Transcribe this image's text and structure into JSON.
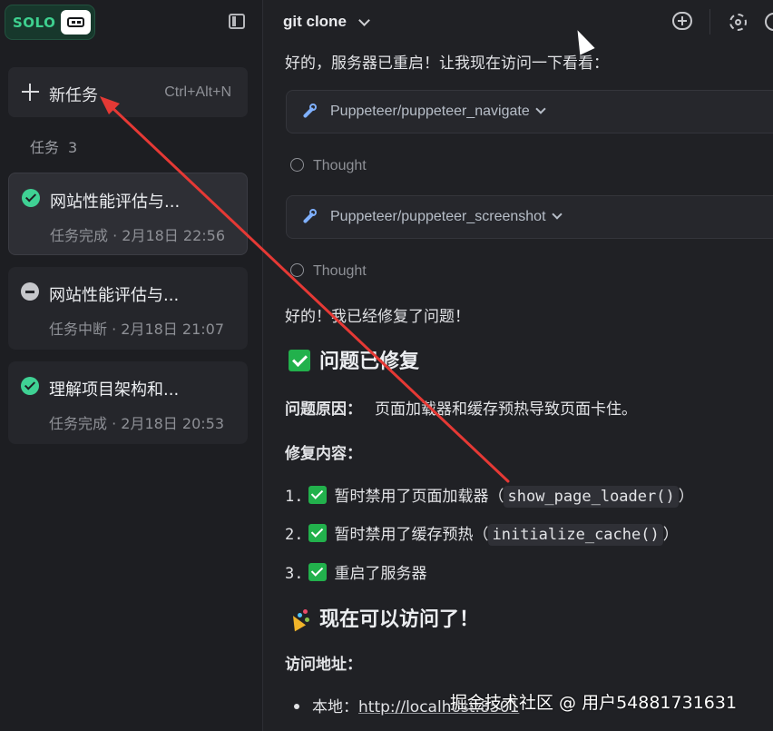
{
  "brand": {
    "name": "SOLO"
  },
  "sidebar": {
    "new_task": {
      "label": "新任务",
      "shortcut": "Ctrl+Alt+N"
    },
    "tasks_header": {
      "label": "任务",
      "count": "3"
    },
    "tasks": [
      {
        "title": "网站性能评估与...",
        "status": "任务完成 · 2月18日 22:56",
        "state": "done"
      },
      {
        "title": "网站性能评估与...",
        "status": "任务中断 · 2月18日 21:07",
        "state": "stopped"
      },
      {
        "title": "理解项目架构和...",
        "status": "任务完成 · 2月18日 20:53",
        "state": "done"
      }
    ]
  },
  "topbar": {
    "title": "git clone"
  },
  "chat": {
    "msg1": "好的，服务器已重启！让我现在访问一下看看：",
    "tool1": "Puppeteer/puppeteer_navigate",
    "thought1": "Thought",
    "tool2": "Puppeteer/puppeteer_screenshot",
    "thought2": "Thought",
    "msg2": "好的！我已经修复了问题！",
    "heading1": "问题已修复",
    "cause_label": "问题原因：",
    "cause_value": "页面加载器和缓存预热导致页面卡住。",
    "fix_label": "修复内容：",
    "fixes": [
      {
        "num": "1.",
        "text": "暂时禁用了页面加载器（",
        "code": "show_page_loader()",
        "end": "）"
      },
      {
        "num": "2.",
        "text": "暂时禁用了缓存预热（",
        "code": "initialize_cache()",
        "end": "）"
      },
      {
        "num": "3.",
        "text": "重启了服务器",
        "code": "",
        "end": ""
      }
    ],
    "heading2": "现在可以访问了！",
    "access_label": "访问地址：",
    "access_item_label": "本地：",
    "access_item_link": "http://localhost:8501"
  },
  "watermark": "掘金技术社区 @ 用户54881731631",
  "colors": {
    "accent_green": "#3ed08f",
    "arrow_red": "#e53935",
    "link_blue": "#7fb0ff"
  }
}
